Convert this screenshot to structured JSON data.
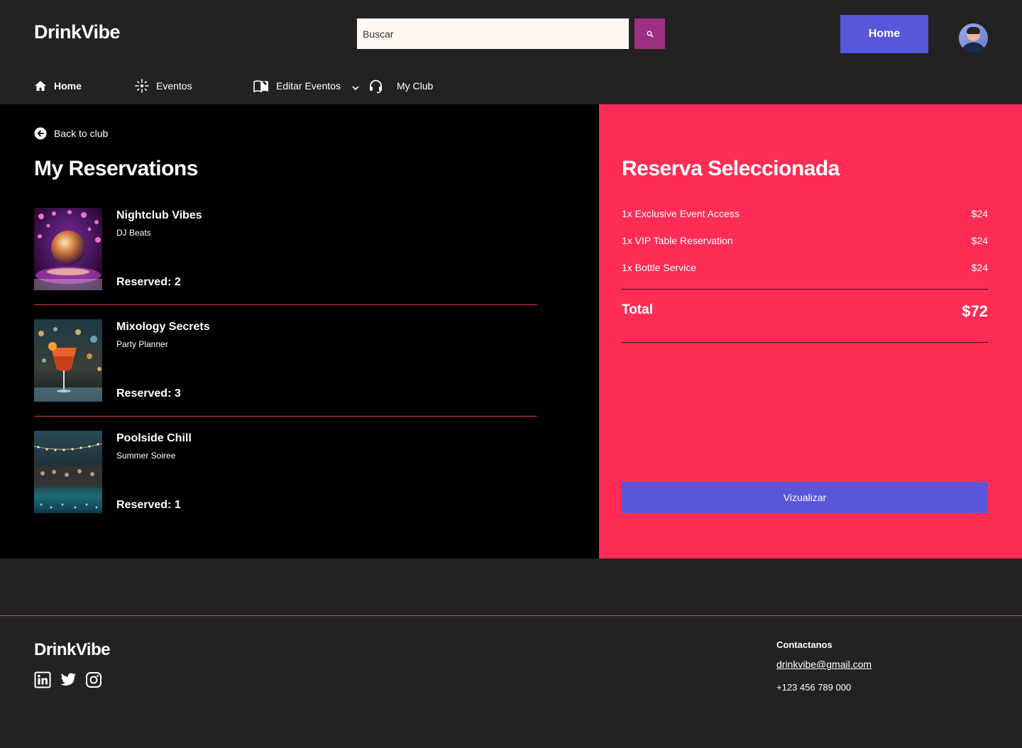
{
  "app": {
    "name": "DrinkVibe"
  },
  "header": {
    "search_placeholder": "Buscar",
    "home_label": "Home"
  },
  "nav": {
    "items": [
      {
        "label": "Home",
        "icon": "home-icon"
      },
      {
        "label": "Eventos",
        "icon": "sparkle-icon"
      },
      {
        "label": "Editar Eventos",
        "icon": "book-icon"
      },
      {
        "label": "My Club",
        "icon": "headset-icon"
      }
    ]
  },
  "reservations": {
    "back_label": "Back to club",
    "title": "My Reservations",
    "items": [
      {
        "title": "Nightclub Vibes",
        "subtitle": "DJ Beats",
        "reserved": "Reserved: 2"
      },
      {
        "title": "Mixology Secrets",
        "subtitle": "Party Planner",
        "reserved": "Reserved: 3"
      },
      {
        "title": "Poolside Chill",
        "subtitle": "Summer Soiree",
        "reserved": "Reserved: 1"
      }
    ]
  },
  "selected": {
    "title": "Reserva Seleccionada",
    "lines": [
      {
        "name": "1x Exclusive Event Access",
        "price": "$24"
      },
      {
        "name": "1x VIP Table Reservation",
        "price": "$24"
      },
      {
        "name": "1x Bottle Service",
        "price": "$24"
      }
    ],
    "total_label": "Total",
    "total_value": "$72",
    "button_label": "Vizualizar"
  },
  "footer": {
    "logo": "DrinkVibe",
    "contact_title": "Contactanos",
    "email": "drinkvibe@gmail.com",
    "phone": "+123 456 789 000",
    "socials": [
      "linkedin-icon",
      "twitter-icon",
      "instagram-icon"
    ]
  },
  "colors": {
    "background": "#222222",
    "main_bg": "#000000",
    "accent_red": "#ff2d55",
    "button_purple": "#5a56d9",
    "search_button": "#9c2f7f"
  }
}
